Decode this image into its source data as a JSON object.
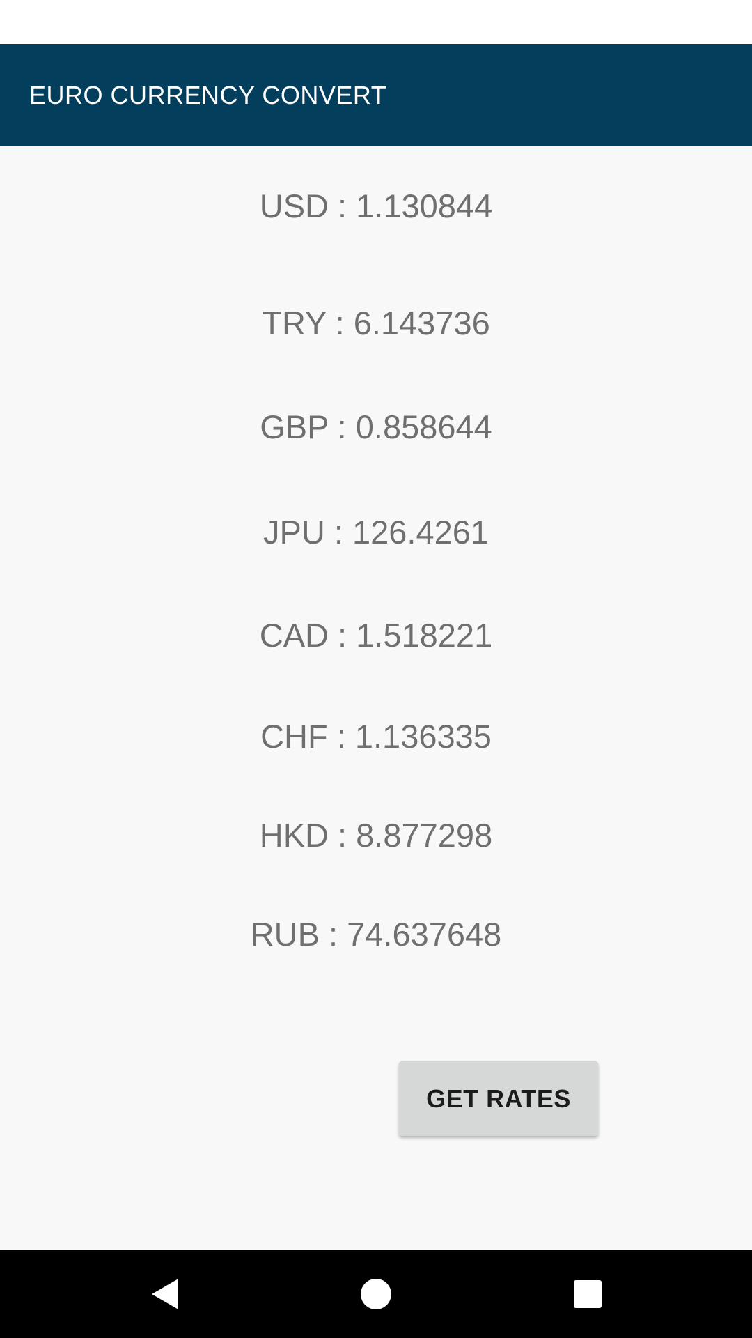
{
  "app": {
    "title": "EURO CURRENCY CONVERT"
  },
  "rates": [
    {
      "code": "USD",
      "value": "1.130844",
      "text": "USD : 1.130844"
    },
    {
      "code": "TRY",
      "value": "6.143736",
      "text": "TRY : 6.143736"
    },
    {
      "code": "GBP",
      "value": "0.858644",
      "text": "GBP : 0.858644"
    },
    {
      "code": "JPU",
      "value": "126.4261",
      "text": "JPU : 126.4261"
    },
    {
      "code": "CAD",
      "value": "1.518221",
      "text": "CAD : 1.518221"
    },
    {
      "code": "CHF",
      "value": "1.136335",
      "text": "CHF : 1.136335"
    },
    {
      "code": "HKD",
      "value": "8.877298",
      "text": "HKD : 8.877298"
    },
    {
      "code": "RUB",
      "value": "74.637648",
      "text": "RUB : 74.637648"
    }
  ],
  "actions": {
    "get_rates_label": "GET RATES"
  },
  "navigation": {
    "icons": [
      "back-icon",
      "home-icon",
      "recents-icon"
    ]
  },
  "colors": {
    "app_bar": "#033f5d",
    "background": "#f8f8f8",
    "rate_text": "#6f6f6f",
    "button": "#d6d7d7"
  }
}
